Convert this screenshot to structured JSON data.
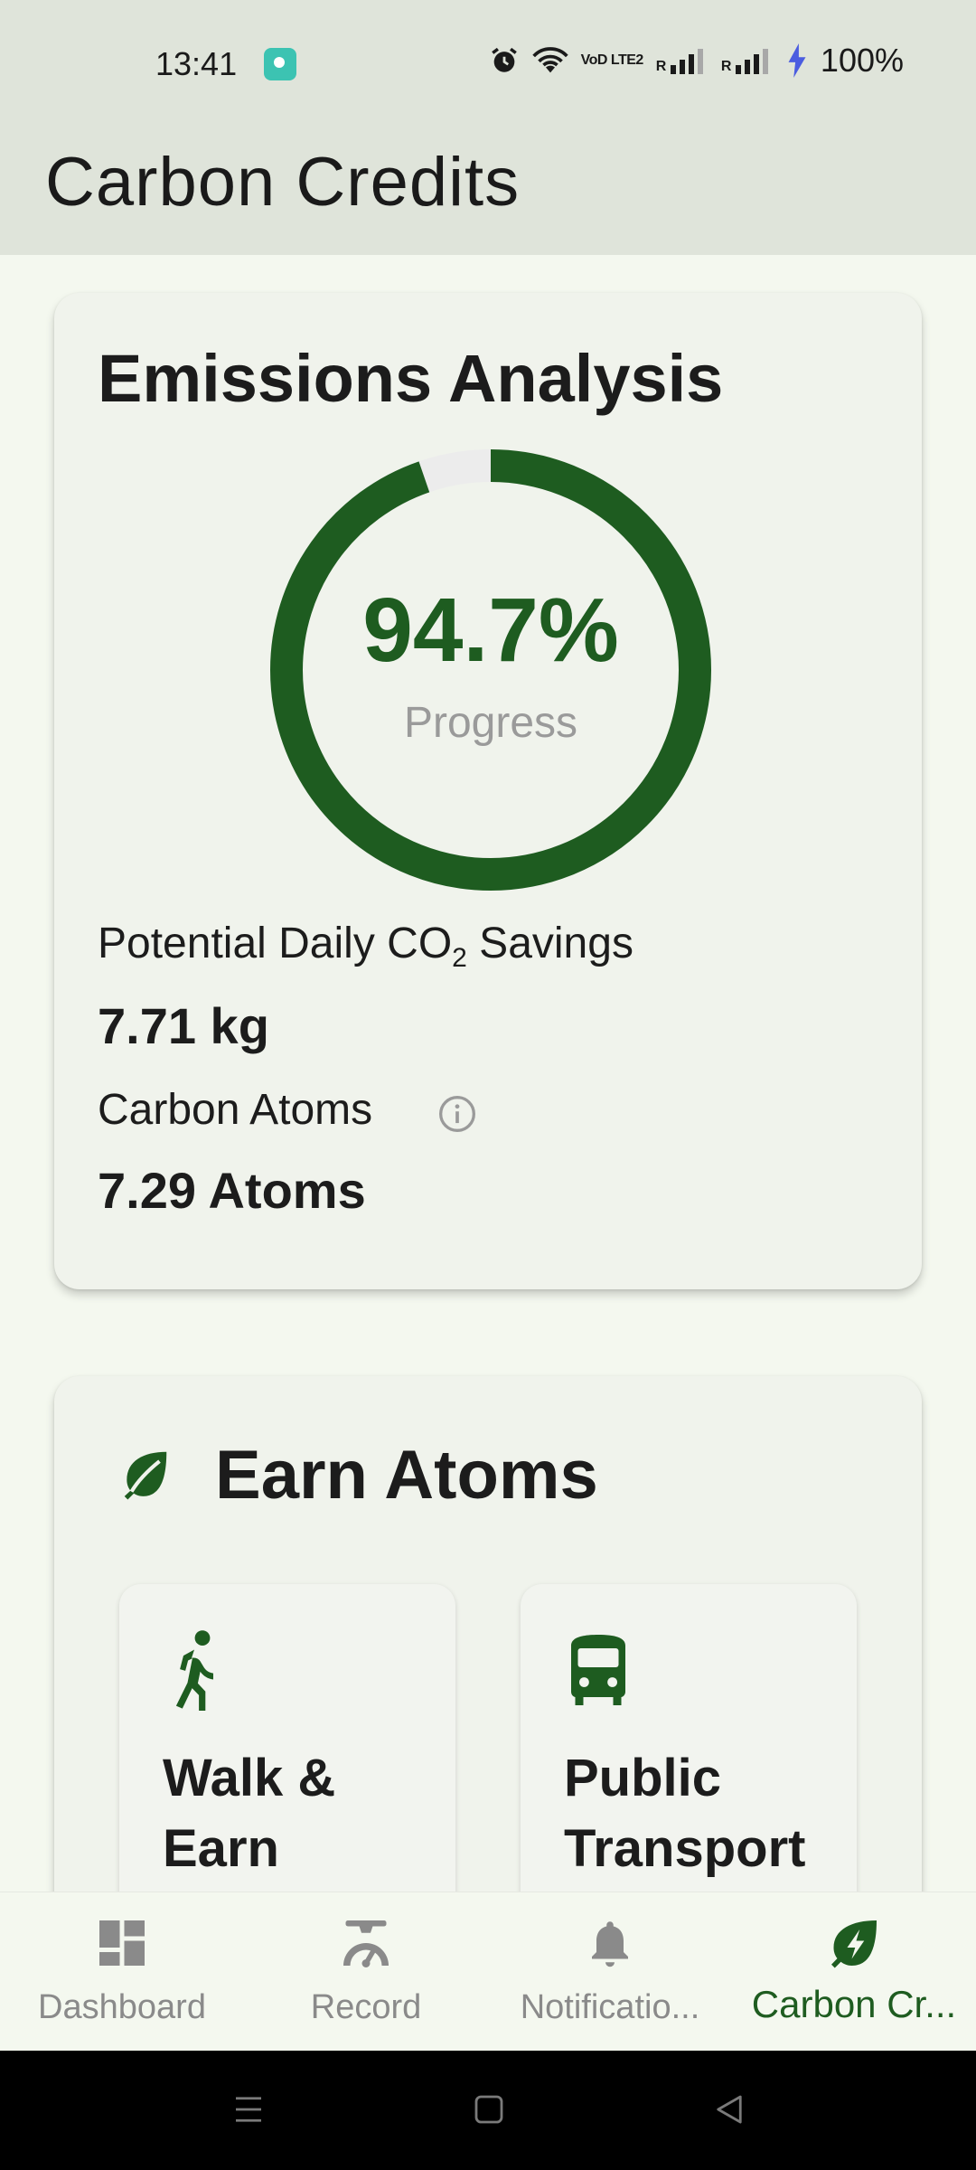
{
  "status_bar": {
    "time": "13:41",
    "signal_text": "VoD LTE2",
    "roaming_1": "R",
    "roaming_2": "R",
    "battery": "100%"
  },
  "app_bar": {
    "title": "Carbon Credits"
  },
  "emissions": {
    "title": "Emissions Analysis",
    "progress": {
      "value_text": "94.7%",
      "value": 94.7,
      "label": "Progress"
    },
    "savings_label_prefix": "Potential Daily CO",
    "savings_label_sub": "2",
    "savings_label_suffix": " Savings",
    "savings_value": "7.71 kg",
    "atoms_label": "Carbon Atoms",
    "atoms_value": "7.29 Atoms"
  },
  "earn": {
    "title": "Earn Atoms",
    "items": [
      {
        "label": "Walk & Earn",
        "icon": "walking-icon"
      },
      {
        "label": "Public Transport",
        "icon": "bus-icon"
      }
    ]
  },
  "bottom_nav": {
    "items": [
      {
        "label": "Dashboard",
        "icon": "dashboard-icon"
      },
      {
        "label": "Record",
        "icon": "scale-icon"
      },
      {
        "label": "Notificatio...",
        "icon": "bell-icon"
      },
      {
        "label": "Carbon Cr...",
        "icon": "leaf-bolt-icon"
      }
    ],
    "active_index": 3
  },
  "colors": {
    "primary": "#1e5c20",
    "ring_track": "#ececec",
    "appbar_bg": "#dfe4da",
    "page_bg": "#f4f8ef",
    "inactive": "#8a8a8a"
  }
}
